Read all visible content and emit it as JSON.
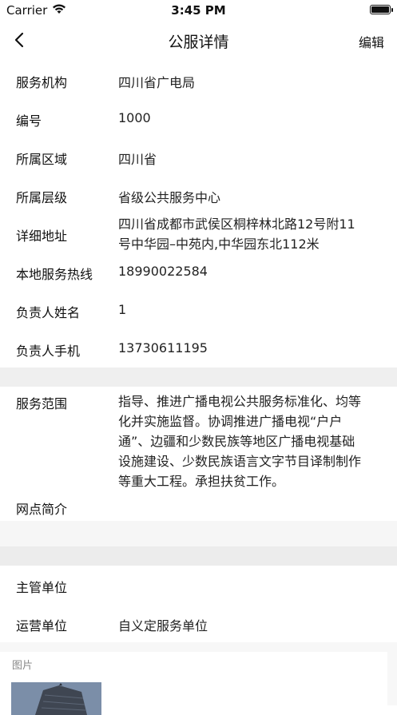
{
  "status_bar": {
    "carrier": "Carrier",
    "time": "3:45 PM"
  },
  "nav": {
    "title": "公服详情",
    "edit_label": "编辑"
  },
  "rows": [
    {
      "label": "服务机构",
      "value": "四川省广电局"
    },
    {
      "label": "编号",
      "value": "1000"
    },
    {
      "label": "所属区域",
      "value": "四川省"
    },
    {
      "label": "所属层级",
      "value": "省级公共服务中心"
    },
    {
      "label": "详细地址",
      "value": "四川省成都市武侯区桐梓林北路12号附11号中华园–中苑内,中华园东北112米"
    },
    {
      "label": "本地服务热线",
      "value": "18990022584"
    },
    {
      "label": "负责人姓名",
      "value": "1"
    },
    {
      "label": "负责人手机",
      "value": "13730611195"
    }
  ],
  "service_scope": {
    "label": "服务范围",
    "value": "指导、推进广播电视公共服务标准化、均等化并实施监督。协调推进广播电视“户户通”、边疆和少数民族等地区广播电视基础设施建设、少数民族语言文字节目译制制作等重大工程。承担扶贫工作。"
  },
  "network_intro": {
    "label": "网点简介",
    "value": ""
  },
  "units": [
    {
      "label": "主管单位",
      "value": ""
    },
    {
      "label": "运营单位",
      "value": "自义定服务单位"
    }
  ],
  "images": {
    "label": "图片"
  }
}
